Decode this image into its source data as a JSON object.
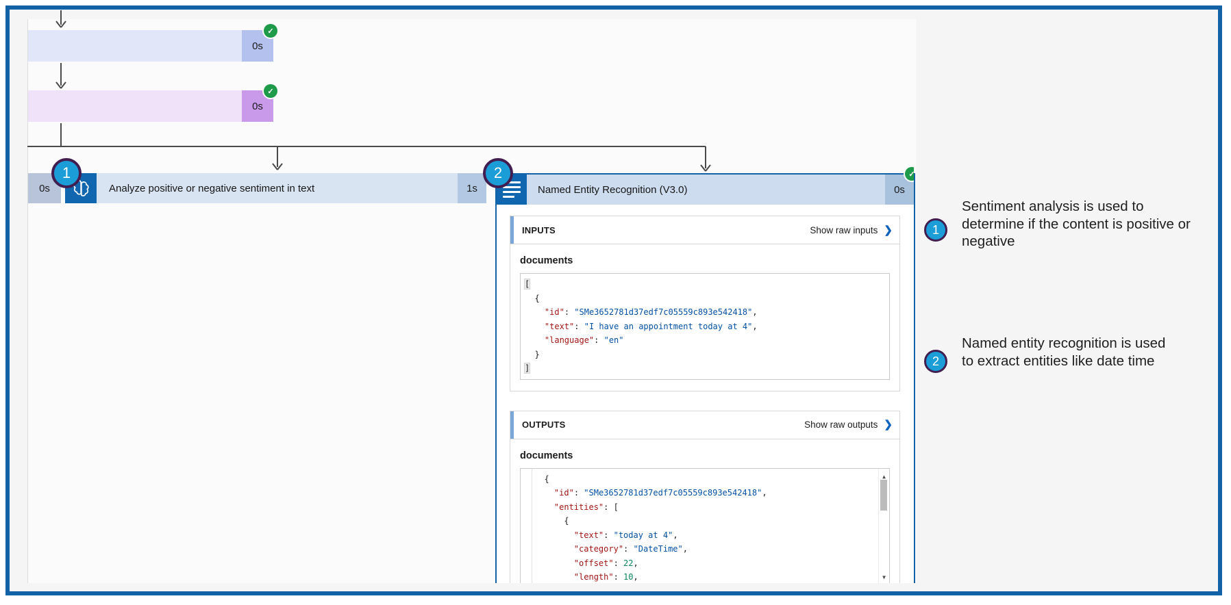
{
  "flow": {
    "action1": {
      "duration": "0s"
    },
    "action2": {
      "duration": "0s"
    },
    "sentiment": {
      "duration": "0s",
      "title": "Analyze positive or negative sentiment in text",
      "elapsed": "1s"
    },
    "ner": {
      "title": "Named Entity Recognition (V3.0)",
      "duration": "0s"
    },
    "check_glyph": "✓"
  },
  "panel": {
    "inputs": {
      "title": "INPUTS",
      "link": "Show raw inputs",
      "chevron": "❯",
      "field": "documents",
      "code": [
        [
          {
            "c": "hl",
            "t": "["
          }
        ],
        [
          {
            "c": "p",
            "t": "  {"
          }
        ],
        [
          {
            "c": "p",
            "t": "    "
          },
          {
            "c": "k",
            "t": "\"id\""
          },
          {
            "c": "p",
            "t": ": "
          },
          {
            "c": "s",
            "t": "\"SMe3652781d37edf7c05559c893e542418\""
          },
          {
            "c": "p",
            "t": ","
          }
        ],
        [
          {
            "c": "p",
            "t": "    "
          },
          {
            "c": "k",
            "t": "\"text\""
          },
          {
            "c": "p",
            "t": ": "
          },
          {
            "c": "s",
            "t": "\"I have an appointment today at 4\""
          },
          {
            "c": "p",
            "t": ","
          }
        ],
        [
          {
            "c": "p",
            "t": "    "
          },
          {
            "c": "k",
            "t": "\"language\""
          },
          {
            "c": "p",
            "t": ": "
          },
          {
            "c": "s",
            "t": "\"en\""
          }
        ],
        [
          {
            "c": "p",
            "t": "  }"
          }
        ],
        [
          {
            "c": "hl",
            "t": "]"
          }
        ]
      ]
    },
    "outputs": {
      "title": "OUTPUTS",
      "link": "Show raw outputs",
      "chevron": "❯",
      "field": "documents",
      "scroll_up": "▲",
      "scroll_down": "▼",
      "code": [
        [
          {
            "c": "p",
            "t": "  {"
          }
        ],
        [
          {
            "c": "p",
            "t": "    "
          },
          {
            "c": "k",
            "t": "\"id\""
          },
          {
            "c": "p",
            "t": ": "
          },
          {
            "c": "s",
            "t": "\"SMe3652781d37edf7c05559c893e542418\""
          },
          {
            "c": "p",
            "t": ","
          }
        ],
        [
          {
            "c": "p",
            "t": "    "
          },
          {
            "c": "k",
            "t": "\"entities\""
          },
          {
            "c": "p",
            "t": ": ["
          }
        ],
        [
          {
            "c": "p",
            "t": "      {"
          }
        ],
        [
          {
            "c": "p",
            "t": "        "
          },
          {
            "c": "k",
            "t": "\"text\""
          },
          {
            "c": "p",
            "t": ": "
          },
          {
            "c": "s",
            "t": "\"today at 4\""
          },
          {
            "c": "p",
            "t": ","
          }
        ],
        [
          {
            "c": "p",
            "t": "        "
          },
          {
            "c": "k",
            "t": "\"category\""
          },
          {
            "c": "p",
            "t": ": "
          },
          {
            "c": "s",
            "t": "\"DateTime\""
          },
          {
            "c": "p",
            "t": ","
          }
        ],
        [
          {
            "c": "p",
            "t": "        "
          },
          {
            "c": "k",
            "t": "\"offset\""
          },
          {
            "c": "p",
            "t": ": "
          },
          {
            "c": "n",
            "t": "22"
          },
          {
            "c": "p",
            "t": ","
          }
        ],
        [
          {
            "c": "p",
            "t": "        "
          },
          {
            "c": "k",
            "t": "\"length\""
          },
          {
            "c": "p",
            "t": ": "
          },
          {
            "c": "n",
            "t": "10"
          },
          {
            "c": "p",
            "t": ","
          }
        ]
      ]
    }
  },
  "annotations": [
    {
      "number": "1",
      "text": "Sentiment analysis is used to\ndetermine if the content is positive or\nnegative"
    },
    {
      "number": "2",
      "text": "Named entity recognition is used\nto extract entities like date time"
    }
  ],
  "colors": {
    "accent": "#1362a8",
    "success": "#1e9b4a",
    "callout_fill": "#1b9ed8",
    "callout_ring": "#411e4f"
  }
}
